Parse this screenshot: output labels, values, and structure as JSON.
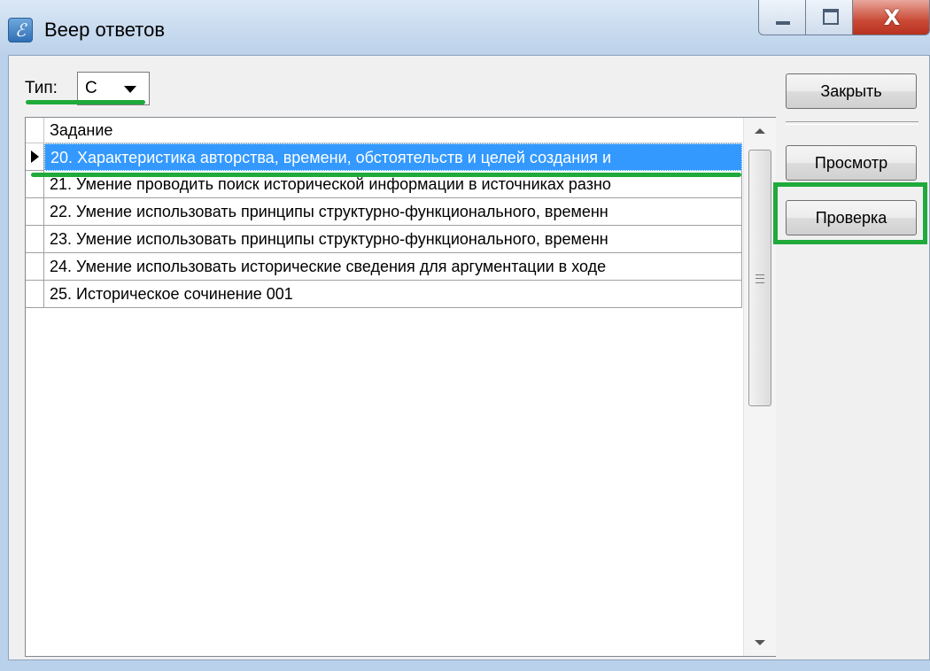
{
  "window": {
    "title": "Веер ответов",
    "app_icon": "quill-icon",
    "controls": {
      "minimize": "minimize-icon",
      "maximize": "maximize-icon",
      "close_glyph": "X"
    }
  },
  "filter": {
    "type_label": "Тип:",
    "type_value": "C"
  },
  "grid": {
    "column_header": "Задание",
    "rows": [
      {
        "text": "20. Характеристика авторства, времени, обстоятельств и целей создания и",
        "selected": true
      },
      {
        "text": "21. Умение проводить поиск исторической информации в источниках разно",
        "selected": false
      },
      {
        "text": "22. Умение использовать принципы структурно-функционального, временн",
        "selected": false
      },
      {
        "text": "23. Умение использовать принципы структурно-функционального, временн",
        "selected": false
      },
      {
        "text": "24. Умение использовать исторические сведения для аргументации в ходе",
        "selected": false
      },
      {
        "text": "25. Историческое сочинение 001",
        "selected": false
      }
    ]
  },
  "buttons": {
    "close": "Закрыть",
    "view": "Просмотр",
    "check": "Проверка"
  },
  "annotation_color": "#1faa3b",
  "selection_color": "#3399ff"
}
